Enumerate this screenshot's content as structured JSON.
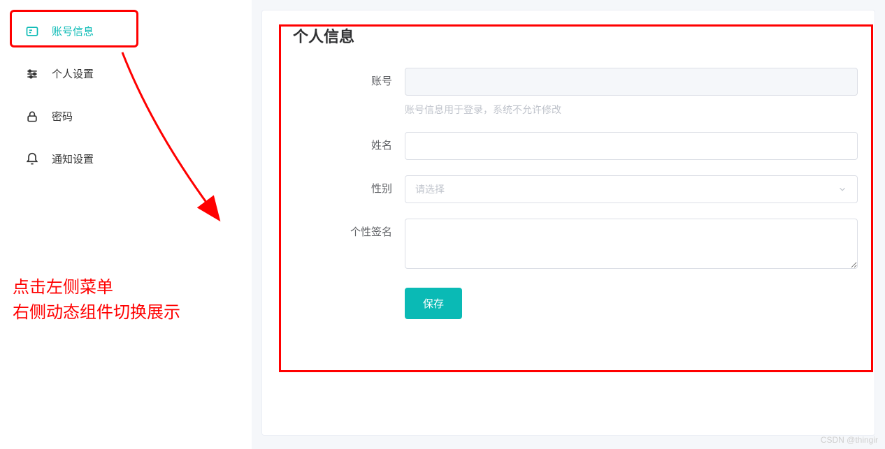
{
  "sidebar": {
    "items": [
      {
        "label": "账号信息",
        "icon": "id-card-icon",
        "active": true
      },
      {
        "label": "个人设置",
        "icon": "sliders-icon",
        "active": false
      },
      {
        "label": "密码",
        "icon": "lock-icon",
        "active": false
      },
      {
        "label": "通知设置",
        "icon": "bell-icon",
        "active": false
      }
    ]
  },
  "annotations": {
    "text_line1": "点击左侧菜单",
    "text_line2": "右侧动态组件切换展示"
  },
  "main": {
    "title": "个人信息",
    "form": {
      "account": {
        "label": "账号",
        "value": "",
        "hint": "账号信息用于登录，系统不允许修改"
      },
      "name": {
        "label": "姓名",
        "value": ""
      },
      "gender": {
        "label": "性别",
        "placeholder": "请选择"
      },
      "signature": {
        "label": "个性签名",
        "value": ""
      },
      "submit_label": "保存"
    }
  },
  "watermark": "CSDN @thingir",
  "colors": {
    "accent": "#0abab5",
    "annotation": "#ff0000"
  }
}
